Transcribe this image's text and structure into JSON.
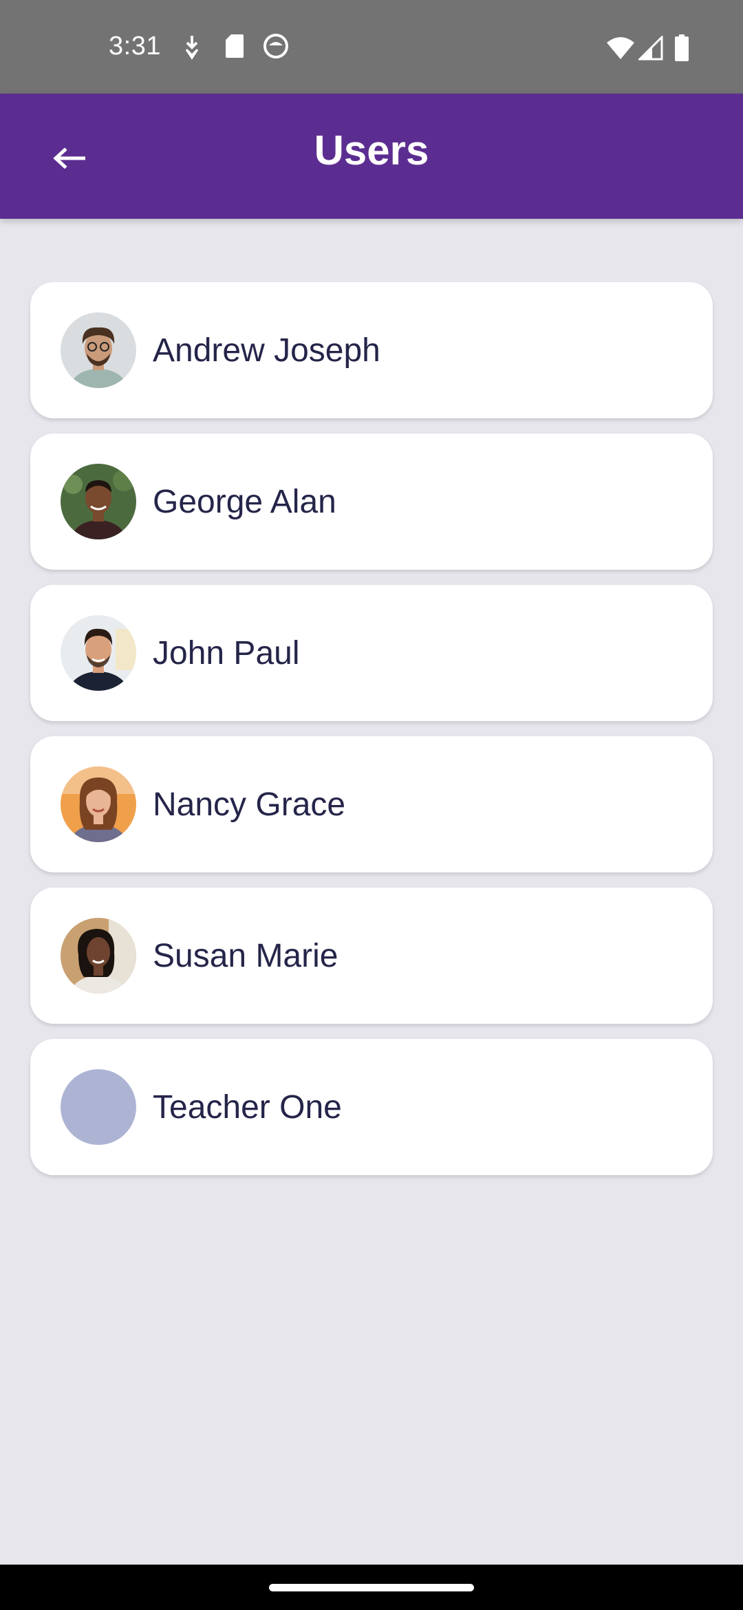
{
  "status_bar": {
    "time": "3:31",
    "left_icons": [
      "download-icon",
      "sd-card-icon",
      "assistant-icon"
    ],
    "right_icons": [
      "wifi-icon",
      "cell-signal-icon",
      "battery-icon"
    ]
  },
  "app_bar": {
    "title": "Users",
    "back_icon": "arrow-left-icon",
    "color": "#5c2d91"
  },
  "users": [
    {
      "name": "Andrew Joseph",
      "avatar": "photo",
      "avatar_colors": {
        "bg": "#d9dde0",
        "skin": "#c99b7a",
        "hair": "#4a3222",
        "shirt": "#9fb5b0"
      }
    },
    {
      "name": "George Alan",
      "avatar": "photo",
      "avatar_colors": {
        "bg": "#4b6b3f",
        "skin": "#7a4a2e",
        "hair": "#1e1410",
        "shirt": "#3a2222"
      }
    },
    {
      "name": "John Paul",
      "avatar": "photo",
      "avatar_colors": {
        "bg": "#e9ecef",
        "skin": "#d9a07c",
        "hair": "#2a1c14",
        "shirt": "#1b2234"
      }
    },
    {
      "name": "Nancy Grace",
      "avatar": "photo",
      "avatar_colors": {
        "bg": "#f0a04b",
        "skin": "#e8b596",
        "hair": "#7a4322",
        "shirt": "#6e6e8e"
      }
    },
    {
      "name": "Susan Marie",
      "avatar": "photo",
      "avatar_colors": {
        "bg": "#c9a071",
        "skin": "#6e4430",
        "hair": "#1a120e",
        "shirt": "#ece8e2"
      }
    },
    {
      "name": "Teacher One",
      "avatar": "placeholder",
      "avatar_colors": {
        "bg": "#adb4d3"
      }
    }
  ]
}
